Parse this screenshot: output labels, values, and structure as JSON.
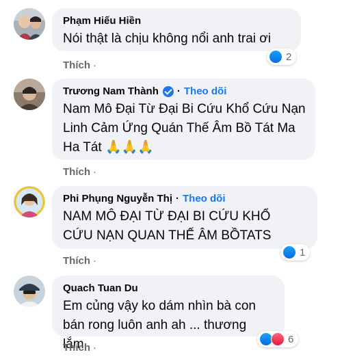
{
  "comments": [
    {
      "author": "Phạm Hiếu Hiền",
      "verified": false,
      "follow": "",
      "text": "Nói thật là chịu không nổi anh trai ơi",
      "action": "Thích",
      "action_sep": "·",
      "reactions": [
        "like-icon"
      ],
      "reaction_count": "2"
    },
    {
      "author": "Trương Nam Thành",
      "verified": true,
      "follow": "Theo dõi",
      "text": "Nam Mô Đại Từ Đại Bi Cứu Khổ Cứu Nạn Linh Cảm Ứng Quán Thế Âm Bồ Tát Ma Ha Tát 🙏🙏🙏",
      "action": "Thích",
      "action_sep": "·"
    },
    {
      "author": "Phi Phụng Nguyễn Thị",
      "verified": false,
      "follow": "Theo dõi",
      "text": "NAM MÔ ĐẠI TỪ ĐẠI BI CỨU KHỔ CỨU NẠN QUAN THẾ ÂM BỒTATS",
      "action": "Thích",
      "action_sep": "·",
      "reactions": [
        "like-icon"
      ],
      "reaction_count": "1"
    },
    {
      "author": "Quach Tuan Du",
      "verified": false,
      "follow": "",
      "text": "Em củng vậy ko dám nhìn bà con bán rong luôn anh ah ... thương lắm",
      "action": "Thích",
      "action_sep": "·",
      "reactions": [
        "like-icon",
        "love-icon"
      ],
      "reaction_count": "6"
    }
  ],
  "colors": {
    "bubble_bg": "#f0f2f5",
    "link_blue": "#1877f2",
    "secondary_text": "#65676b"
  }
}
